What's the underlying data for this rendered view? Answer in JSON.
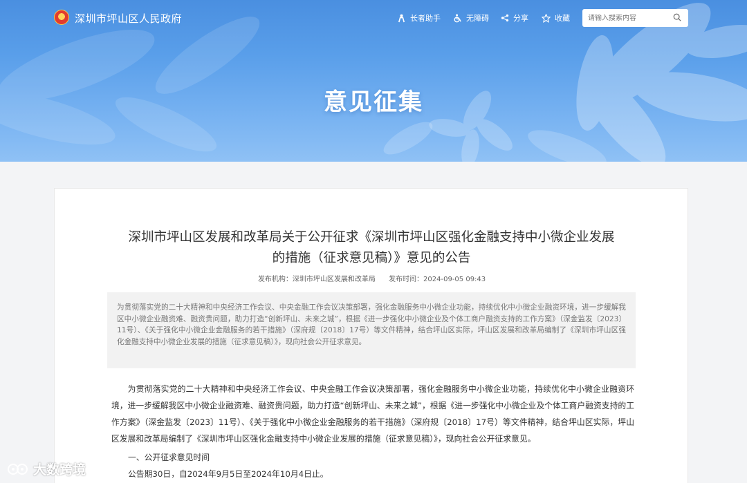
{
  "header": {
    "site_name": "深圳市坪山区人民政府",
    "tools": [
      {
        "label": "长者助手",
        "icon": "elder-assist-icon"
      },
      {
        "label": "无障碍",
        "icon": "accessibility-icon"
      },
      {
        "label": "分享",
        "icon": "share-icon"
      },
      {
        "label": "收藏",
        "icon": "star-icon"
      }
    ],
    "search": {
      "placeholder": "请输入搜索内容"
    }
  },
  "banner": {
    "title": "意见征集"
  },
  "article": {
    "title": "深圳市坪山区发展和改革局关于公开征求《深圳市坪山区强化金融支持中小微企业发展的措施（征求意见稿）》意见的公告",
    "publisher_label": "发布机构：",
    "publisher": "深圳市坪山区发展和改革局",
    "time_label": "发布时间：",
    "time": "2024-09-05 09:43",
    "abstract": "为贯彻落实党的二十大精神和中央经济工作会议、中央金融工作会议决策部署，强化金融服务中小微企业功能，持续优化中小微企业融资环境，进一步缓解我区中小微企业融资难、融资贵问题，助力打造“创新坪山、未来之城”，根据《进一步强化中小微企业及个体工商户融资支持的工作方案》（深金监发〔2023〕11号）、《关于强化中小微企业金融服务的若干措施》（深府规〔2018〕17号）等文件精神，结合坪山区实际，坪山区发展和改革局编制了《深圳市坪山区强化金融支持中小微企业发展的措施（征求意见稿）》，现向社会公开征求意见。",
    "body": "为贯彻落实党的二十大精神和中央经济工作会议、中央金融工作会议决策部署，强化金融服务中小微企业功能，持续优化中小微企业融资环境，进一步缓解我区中小微企业融资难、融资贵问题，助力打造“创新坪山、未来之城”，根据《进一步强化中小微企业及个体工商户融资支持的工作方案》（深金监发〔2023〕11号）、《关于强化中小微企业金融服务的若干措施》（深府规〔2018〕17号）等文件精神，结合坪山区实际，坪山区发展和改革局编制了《深圳市坪山区强化金融支持中小微企业发展的措施（征求意见稿）》，现向社会公开征求意见。",
    "section_1": "一、公开征求意见时间",
    "section_1_text": "公告期30日，自2024年9月5日至2024年10月4日止。"
  },
  "watermark": {
    "text": "大数跨境"
  },
  "colors": {
    "banner": "#5a9fea",
    "text": "#333333",
    "abstract_bg": "#f2f2f2"
  }
}
